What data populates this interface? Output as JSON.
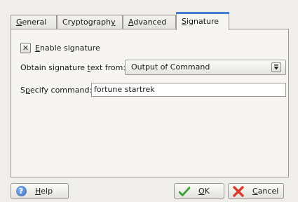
{
  "tabs": [
    {
      "label": "General",
      "mnemonic": "G",
      "rest": "eneral"
    },
    {
      "label": "Cryptography",
      "pre": "Cryptograph",
      "mnemonic": "y"
    },
    {
      "label": "Advanced",
      "mnemonic": "A",
      "rest": "dvanced"
    },
    {
      "label": "Signature",
      "mnemonic": "S",
      "rest": "ignature"
    }
  ],
  "signature": {
    "enable_checked": true,
    "enable_mnemonic": "E",
    "enable_rest": "nable signature",
    "obtain_label_pre": "Obtain signature ",
    "obtain_label_mnemonic": "t",
    "obtain_label_post": "ext from:",
    "source_value": "Output of Command",
    "command_label_pre": "S",
    "command_label_mnemonic": "p",
    "command_label_post": "ecify command:",
    "command_value": "fortune startrek"
  },
  "buttons": {
    "help_mnemonic": "H",
    "help_rest": "elp",
    "ok_mnemonic": "O",
    "ok_rest": "K",
    "cancel_mnemonic": "C",
    "cancel_rest": "ancel"
  },
  "icons": {
    "help": "help-icon",
    "ok": "checkmark-icon",
    "cancel": "cancel-x-icon",
    "combo": "dropdown-arrow-icon",
    "checkbox": "checkbox-x-icon"
  },
  "colors": {
    "active_tab_accent": "#3f7ed0",
    "ok_check": "#3aa235",
    "cancel_x": "#d93a2a"
  }
}
